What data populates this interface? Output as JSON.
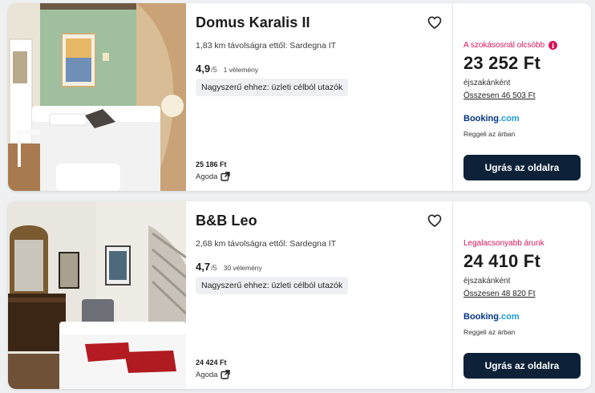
{
  "results": [
    {
      "name": "Domus Karalis II",
      "distance": "1,83 km távolságra ettől: Sardegna IT",
      "rating": "4,9",
      "rating_max": "/5",
      "reviews": "1 vélemény",
      "badge": "Nagyszerű ehhez: üzleti célból utazók",
      "alt_price": "25 186 Ft",
      "alt_provider": "Agoda",
      "deal_label": "A szokásosnál olcsóbb",
      "price": "23 252 Ft",
      "per_night": "éjszakánként",
      "total": "Összesen 46 503 Ft",
      "provider_name": "Booking",
      "provider_tld": ".com",
      "perk": "Reggeli az árban",
      "cta": "Ugrás az oldalra",
      "accent_color": "#d4145a",
      "photo_icon": "room-photo-green-wall"
    },
    {
      "name": "B&B Leo",
      "distance": "2,68 km távolságra ettől: Sardegna IT",
      "rating": "4,7",
      "rating_max": "/5",
      "reviews": "30 vélemény",
      "badge": "Nagyszerű ehhez: üzleti célból utazók",
      "alt_price": "24 424 Ft",
      "alt_provider": "Agoda",
      "deal_label": "Legalacsonyabb árunk",
      "price": "24 410 Ft",
      "per_night": "éjszakánként",
      "total": "Összesen 48 820 Ft",
      "provider_name": "Booking",
      "provider_tld": ".com",
      "perk": "Reggeli az árban",
      "cta": "Ugrás az oldalra",
      "accent_color": "#d4145a",
      "photo_icon": "room-photo-red-towels"
    }
  ],
  "colors": {
    "cta_bg": "#0d2238",
    "booking_blue": "#003580",
    "booking_dot": "#1a9cd8",
    "deal_pink": "#d4145a"
  }
}
